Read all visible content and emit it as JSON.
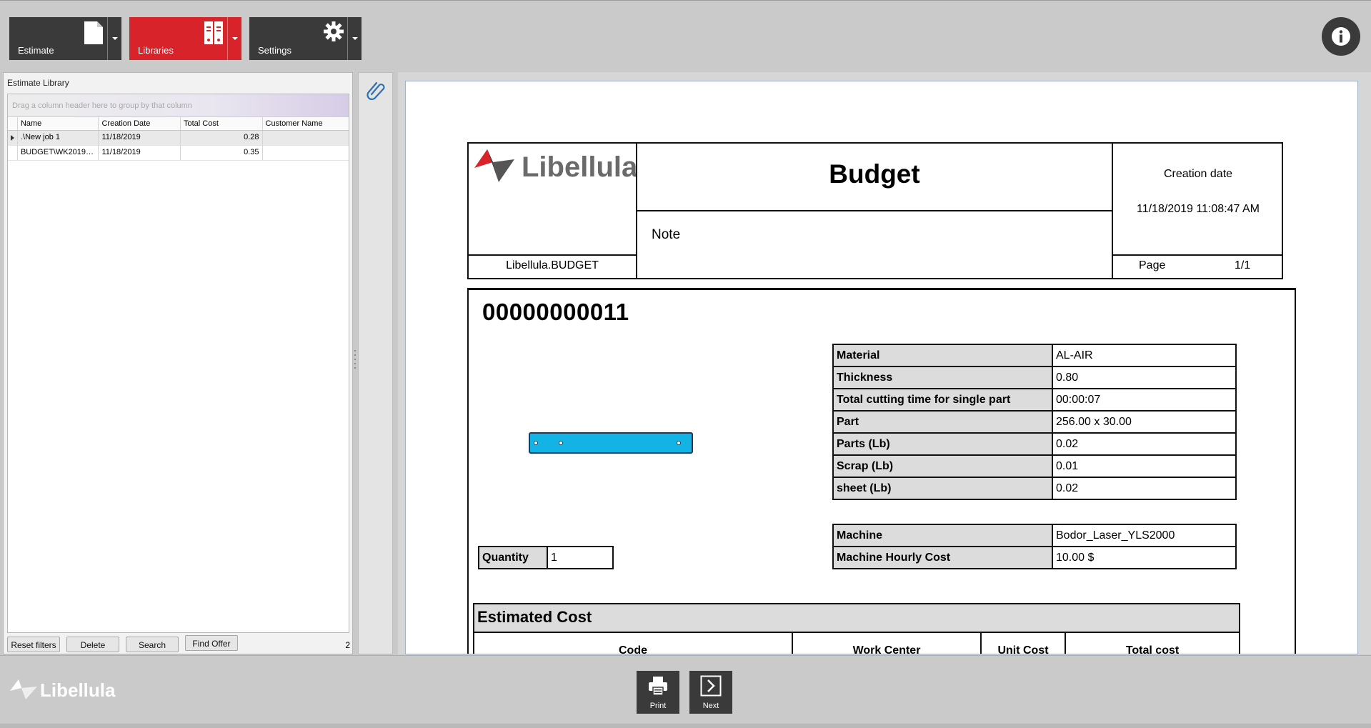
{
  "toolbar": {
    "estimate_label": "Estimate",
    "libraries_label": "Libraries",
    "settings_label": "Settings",
    "info_icon": "info-icon"
  },
  "library": {
    "title": "Estimate Library",
    "group_hint": "Drag a column header here to group by that column",
    "columns": [
      "Name",
      "Creation Date",
      "Total Cost",
      "Customer Name"
    ],
    "rows": [
      {
        "name": ".\\New job 1",
        "date": "11/18/2019",
        "cost": "0.28",
        "customer": ""
      },
      {
        "name": "BUDGET\\WK20191...",
        "date": "11/18/2019",
        "cost": "0.35",
        "customer": ""
      }
    ],
    "buttons": {
      "reset": "Reset filters",
      "delete": "Delete",
      "search": "Search",
      "find": "Find Offer"
    },
    "count": "2"
  },
  "report": {
    "logo_text": "Libellula",
    "title": "Budget",
    "note_label": "Note",
    "creation_label": "Creation date",
    "creation_value": "11/18/2019 11:08:47 AM",
    "footer_left": "Libellula.BUDGET",
    "page_label": "Page",
    "page_value": "1/1",
    "job_id": "00000000011",
    "material_rows": [
      {
        "k": "Material",
        "v": "AL-AIR"
      },
      {
        "k": "Thickness",
        "v": "0.80"
      },
      {
        "k": "Total cutting time for single part",
        "v": "00:00:07"
      },
      {
        "k": "Part",
        "v": "256.00 x 30.00"
      },
      {
        "k": "Parts (Lb)",
        "v": "0.02"
      },
      {
        "k": "Scrap (Lb)",
        "v": "0.01"
      },
      {
        "k": "sheet (Lb)",
        "v": "0.02"
      }
    ],
    "machine_rows": [
      {
        "k": "Machine",
        "v": "Bodor_Laser_YLS2000"
      },
      {
        "k": "Machine Hourly Cost",
        "v": "10.00 $"
      }
    ],
    "quantity_label": "Quantity",
    "quantity_value": "1",
    "estimated_cost_title": "Estimated Cost",
    "cost_columns": [
      "Code",
      "Work Center",
      "Unit Cost",
      "Total cost"
    ]
  },
  "bottom": {
    "brand_text": "Libellula",
    "print_label": "Print",
    "next_label": "Next"
  },
  "colors": {
    "accent_red": "#d8232a",
    "dark_button": "#3a3a3a",
    "part_fill": "#13b3e6"
  }
}
